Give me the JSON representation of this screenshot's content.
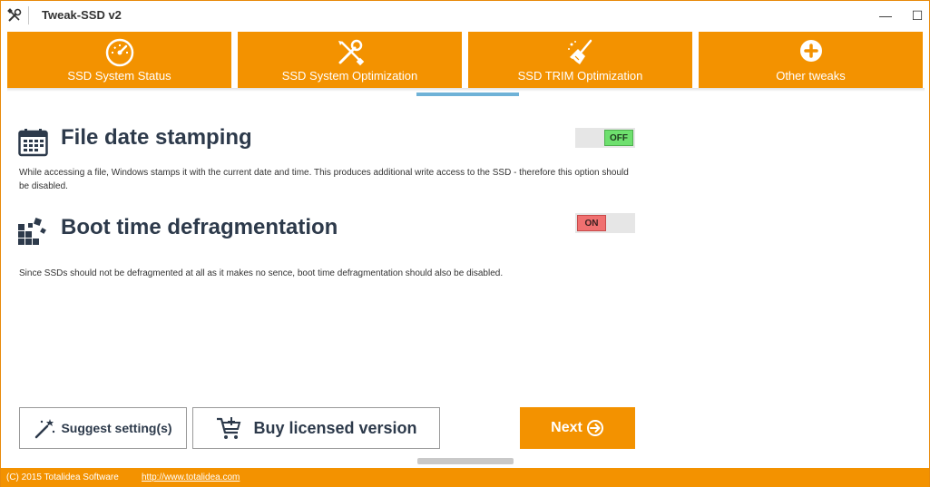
{
  "window": {
    "title": "Tweak-SSD v2",
    "app_icon": "tools-icon",
    "controls": {
      "minimize": "—",
      "maximize": "☐",
      "close": "✕"
    }
  },
  "nav": {
    "tabs": [
      {
        "label": "SSD System Status",
        "icon": "speedometer-icon"
      },
      {
        "label": "SSD System Optimization",
        "icon": "wrench-screwdriver-icon"
      },
      {
        "label": "SSD TRIM Optimization",
        "icon": "broom-icon"
      },
      {
        "label": "Other tweaks",
        "icon": "plus-circle-icon"
      }
    ],
    "active_tab": "SSD TRIM Optimization",
    "accent_color": "#f39200",
    "indicator_color": "#6fb2d7"
  },
  "settings": [
    {
      "title": "File date stamping",
      "icon": "calendar-icon",
      "state": "OFF",
      "state_color": "#6ee06e",
      "description": "While accessing a file, Windows stamps it with the current date and time. This produces additional write access to the SSD - therefore this option should be disabled."
    },
    {
      "title": "Boot time defragmentation",
      "icon": "blocks-icon",
      "state": "ON",
      "state_color": "#f07070",
      "description": "Since SSDs should not be defragmented at all as it makes no sence, boot time defragmentation should also be disabled."
    }
  ],
  "buttons": {
    "suggest": {
      "label": "Suggest setting(s)",
      "icon": "magic-wand-icon"
    },
    "buy": {
      "label": "Buy licensed version",
      "icon": "cart-icon"
    },
    "next": {
      "label": "Next",
      "icon": "arrow-circle-right-icon"
    }
  },
  "footer": {
    "copyright": "(C) 2015 Totalidea Software",
    "link": "http://www.totalidea.com"
  }
}
